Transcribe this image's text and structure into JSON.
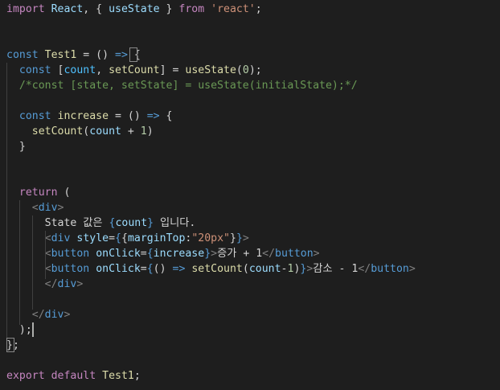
{
  "editor": {
    "language": "javascript-react",
    "lines": [
      [
        [
          "import",
          "#c586c0"
        ],
        [
          " ",
          "#d4d4d4"
        ],
        [
          "React",
          "#9cdcfe"
        ],
        [
          ", { ",
          "#d4d4d4"
        ],
        [
          "useState",
          "#9cdcfe"
        ],
        [
          " } ",
          "#d4d4d4"
        ],
        [
          "from",
          "#c586c0"
        ],
        [
          " ",
          "#d4d4d4"
        ],
        [
          "'react'",
          "#ce9178"
        ],
        [
          ";",
          "#d4d4d4"
        ]
      ],
      [],
      [],
      [
        [
          "const",
          "#569cd6"
        ],
        [
          " ",
          "#d4d4d4"
        ],
        [
          "Test1",
          "#dcdcaa"
        ],
        [
          " = () ",
          "#d4d4d4"
        ],
        [
          "=>",
          "#569cd6"
        ],
        [
          " ",
          "#d4d4d4"
        ],
        [
          "{",
          "#d4d4d4"
        ]
      ],
      [
        [
          "  ",
          "#d4d4d4"
        ],
        [
          "const",
          "#569cd6"
        ],
        [
          " [",
          "#d4d4d4"
        ],
        [
          "count",
          "#4fc1ff"
        ],
        [
          ", ",
          "#d4d4d4"
        ],
        [
          "setCount",
          "#dcdcaa"
        ],
        [
          "] = ",
          "#d4d4d4"
        ],
        [
          "useState",
          "#dcdcaa"
        ],
        [
          "(",
          "#d4d4d4"
        ],
        [
          "0",
          "#b5cea8"
        ],
        [
          ");",
          "#d4d4d4"
        ]
      ],
      [
        [
          "  ",
          "#d4d4d4"
        ],
        [
          "/*const [state, setState] = useState(initialState);*/",
          "#6a9955"
        ]
      ],
      [],
      [
        [
          "  ",
          "#d4d4d4"
        ],
        [
          "const",
          "#569cd6"
        ],
        [
          " ",
          "#d4d4d4"
        ],
        [
          "increase",
          "#dcdcaa"
        ],
        [
          " = () ",
          "#d4d4d4"
        ],
        [
          "=>",
          "#569cd6"
        ],
        [
          " {",
          "#d4d4d4"
        ]
      ],
      [
        [
          "    ",
          "#d4d4d4"
        ],
        [
          "setCount",
          "#dcdcaa"
        ],
        [
          "(",
          "#d4d4d4"
        ],
        [
          "count",
          "#9cdcfe"
        ],
        [
          " + ",
          "#d4d4d4"
        ],
        [
          "1",
          "#b5cea8"
        ],
        [
          ")",
          "#d4d4d4"
        ]
      ],
      [
        [
          "  ",
          "#d4d4d4"
        ],
        [
          "}",
          "#d4d4d4"
        ]
      ],
      [],
      [],
      [
        [
          "  ",
          "#d4d4d4"
        ],
        [
          "return",
          "#c586c0"
        ],
        [
          " (",
          "#d4d4d4"
        ]
      ],
      [
        [
          "    ",
          "#d4d4d4"
        ],
        [
          "<",
          "#808080"
        ],
        [
          "div",
          "#569cd6"
        ],
        [
          ">",
          "#808080"
        ]
      ],
      [
        [
          "      ",
          "#d4d4d4"
        ],
        [
          "State 값은 ",
          "#d4d4d4"
        ],
        [
          "{",
          "#569cd6"
        ],
        [
          "count",
          "#9cdcfe"
        ],
        [
          "}",
          "#569cd6"
        ],
        [
          " 입니다.",
          "#d4d4d4"
        ]
      ],
      [
        [
          "      ",
          "#d4d4d4"
        ],
        [
          "<",
          "#808080"
        ],
        [
          "div",
          "#569cd6"
        ],
        [
          " ",
          "#d4d4d4"
        ],
        [
          "style",
          "#9cdcfe"
        ],
        [
          "=",
          "#d4d4d4"
        ],
        [
          "{",
          "#569cd6"
        ],
        [
          "{",
          "#d4d4d4"
        ],
        [
          "marginTop",
          "#9cdcfe"
        ],
        [
          ":",
          "#d4d4d4"
        ],
        [
          "\"20px\"",
          "#ce9178"
        ],
        [
          "}",
          "#d4d4d4"
        ],
        [
          "}",
          "#569cd6"
        ],
        [
          ">",
          "#808080"
        ]
      ],
      [
        [
          "      ",
          "#d4d4d4"
        ],
        [
          "<",
          "#808080"
        ],
        [
          "button",
          "#569cd6"
        ],
        [
          " ",
          "#d4d4d4"
        ],
        [
          "onClick",
          "#9cdcfe"
        ],
        [
          "=",
          "#d4d4d4"
        ],
        [
          "{",
          "#569cd6"
        ],
        [
          "increase",
          "#9cdcfe"
        ],
        [
          "}",
          "#569cd6"
        ],
        [
          ">",
          "#808080"
        ],
        [
          "증가 + 1",
          "#d4d4d4"
        ],
        [
          "</",
          "#808080"
        ],
        [
          "button",
          "#569cd6"
        ],
        [
          ">",
          "#808080"
        ]
      ],
      [
        [
          "      ",
          "#d4d4d4"
        ],
        [
          "<",
          "#808080"
        ],
        [
          "button",
          "#569cd6"
        ],
        [
          " ",
          "#d4d4d4"
        ],
        [
          "onClick",
          "#9cdcfe"
        ],
        [
          "=",
          "#d4d4d4"
        ],
        [
          "{",
          "#569cd6"
        ],
        [
          "() ",
          "#d4d4d4"
        ],
        [
          "=>",
          "#569cd6"
        ],
        [
          " ",
          "#d4d4d4"
        ],
        [
          "setCount",
          "#dcdcaa"
        ],
        [
          "(",
          "#d4d4d4"
        ],
        [
          "count",
          "#9cdcfe"
        ],
        [
          "-",
          "#d4d4d4"
        ],
        [
          "1",
          "#b5cea8"
        ],
        [
          ")",
          "#d4d4d4"
        ],
        [
          "}",
          "#569cd6"
        ],
        [
          ">",
          "#808080"
        ],
        [
          "감소 - 1",
          "#d4d4d4"
        ],
        [
          "</",
          "#808080"
        ],
        [
          "button",
          "#569cd6"
        ],
        [
          ">",
          "#808080"
        ]
      ],
      [
        [
          "      ",
          "#d4d4d4"
        ],
        [
          "</",
          "#808080"
        ],
        [
          "div",
          "#569cd6"
        ],
        [
          ">",
          "#808080"
        ]
      ],
      [],
      [
        [
          "    ",
          "#d4d4d4"
        ],
        [
          "</",
          "#808080"
        ],
        [
          "div",
          "#569cd6"
        ],
        [
          ">",
          "#808080"
        ]
      ],
      [
        [
          "  ",
          "#d4d4d4"
        ],
        [
          ");",
          "#d4d4d4"
        ]
      ],
      [
        [
          "};",
          "#d4d4d4"
        ]
      ],
      [],
      [
        [
          "export",
          "#c586c0"
        ],
        [
          " ",
          "#d4d4d4"
        ],
        [
          "default",
          "#c586c0"
        ],
        [
          " ",
          "#d4d4d4"
        ],
        [
          "Test1",
          "#dcdcaa"
        ],
        [
          ";",
          "#d4d4d4"
        ]
      ]
    ]
  },
  "colors": {
    "background": "#1e1e1e",
    "indent_guide": "#404040",
    "cursor": "#aeafad",
    "bracket_match": "#888888"
  }
}
